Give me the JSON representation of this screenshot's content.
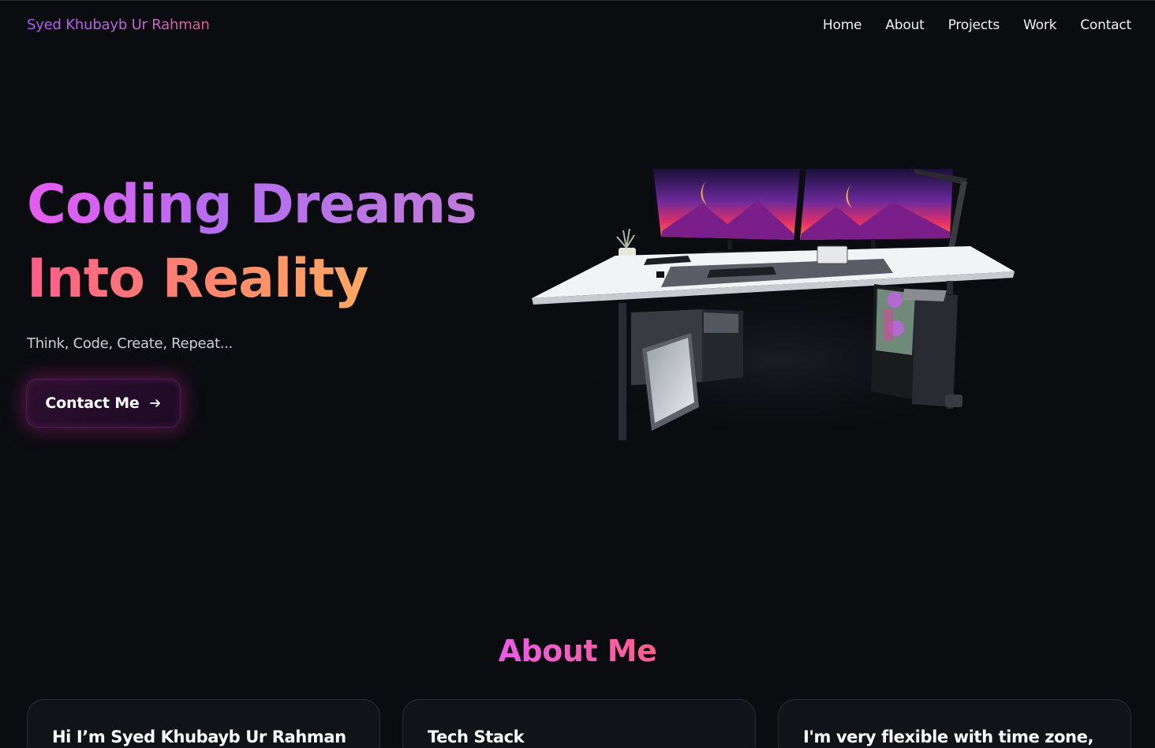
{
  "nav": {
    "brand": "Syed Khubayb Ur Rahman",
    "links": [
      "Home",
      "About",
      "Projects",
      "Work",
      "Contact"
    ]
  },
  "hero": {
    "title_line1": "Coding Dreams",
    "title_line2": "Into Reality",
    "tagline": "Think, Code, Create, Repeat...",
    "cta_label": "Contact Me",
    "cta_icon": "arrow-right-icon",
    "illustration": "3d-desk-setup"
  },
  "about": {
    "heading": "About Me",
    "cards": [
      {
        "title": "Hi I’m Syed Khubayb Ur Rahman"
      },
      {
        "title": "Tech Stack"
      },
      {
        "title": "I'm very flexible with time zone,"
      }
    ]
  },
  "colors": {
    "background": "#0b0c10",
    "accent_purple": "#b35cf5",
    "accent_pink": "#ff5e8a",
    "accent_orange": "#ffc060"
  }
}
